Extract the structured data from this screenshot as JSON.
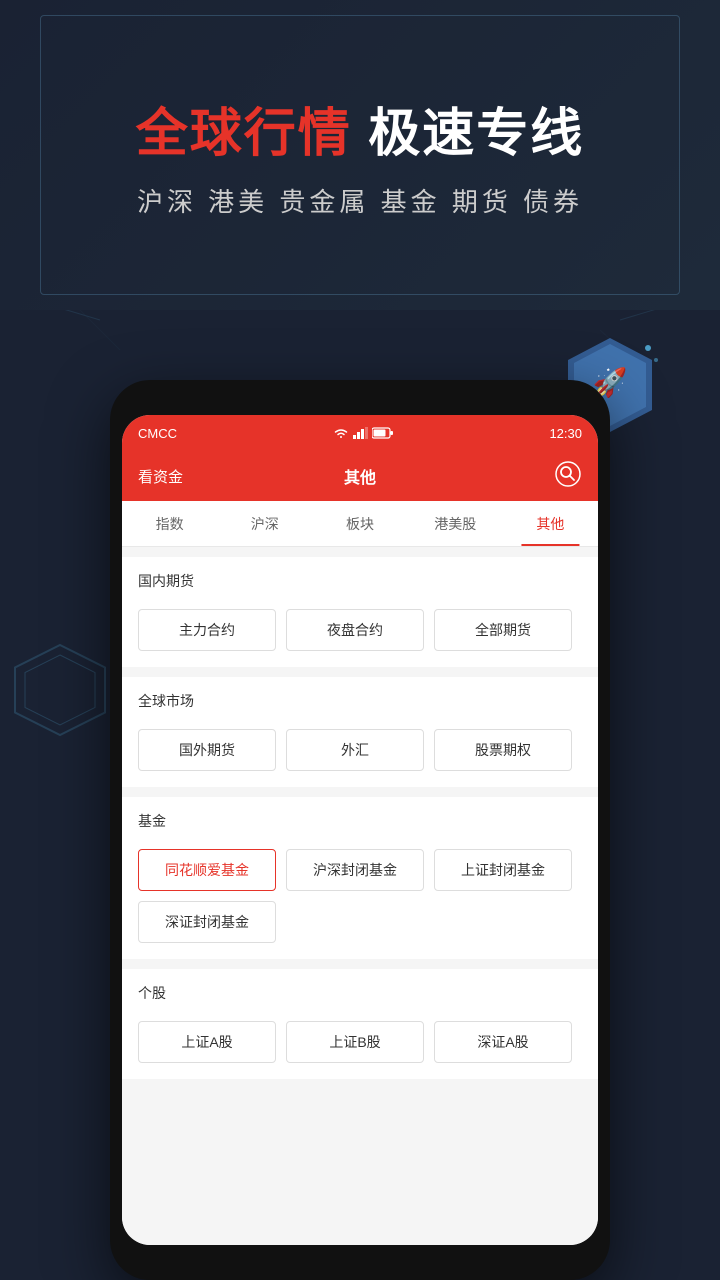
{
  "banner": {
    "title_red": "全球行情",
    "title_white": " 极速专线",
    "subtitle": "沪深 港美 贵金属 基金 期货 债券"
  },
  "status_bar": {
    "carrier": "CMCC",
    "time": "12:30"
  },
  "header": {
    "left": "看资金",
    "center": "其他",
    "search_label": "搜索"
  },
  "tabs": [
    {
      "label": "指数",
      "active": false
    },
    {
      "label": "沪深",
      "active": false
    },
    {
      "label": "板块",
      "active": false
    },
    {
      "label": "港美股",
      "active": false
    },
    {
      "label": "其他",
      "active": true
    }
  ],
  "sections": [
    {
      "title": "国内期货",
      "buttons": [
        {
          "label": "主力合约",
          "selected": false
        },
        {
          "label": "夜盘合约",
          "selected": false
        },
        {
          "label": "全部期货",
          "selected": false
        }
      ]
    },
    {
      "title": "全球市场",
      "buttons": [
        {
          "label": "国外期货",
          "selected": false
        },
        {
          "label": "外汇",
          "selected": false
        },
        {
          "label": "股票期权",
          "selected": false
        }
      ]
    },
    {
      "title": "基金",
      "buttons": [
        {
          "label": "同花顺爱基金",
          "selected": true
        },
        {
          "label": "沪深封闭基金",
          "selected": false
        },
        {
          "label": "上证封闭基金",
          "selected": false
        },
        {
          "label": "深证封闭基金",
          "selected": false
        }
      ]
    },
    {
      "title": "个股",
      "buttons": [
        {
          "label": "上证A股",
          "selected": false
        },
        {
          "label": "上证B股",
          "selected": false
        },
        {
          "label": "深证A股",
          "selected": false
        }
      ]
    }
  ],
  "colors": {
    "primary_red": "#e63329",
    "dark_bg": "#1a2233",
    "text_dark": "#333",
    "text_gray": "#666"
  }
}
